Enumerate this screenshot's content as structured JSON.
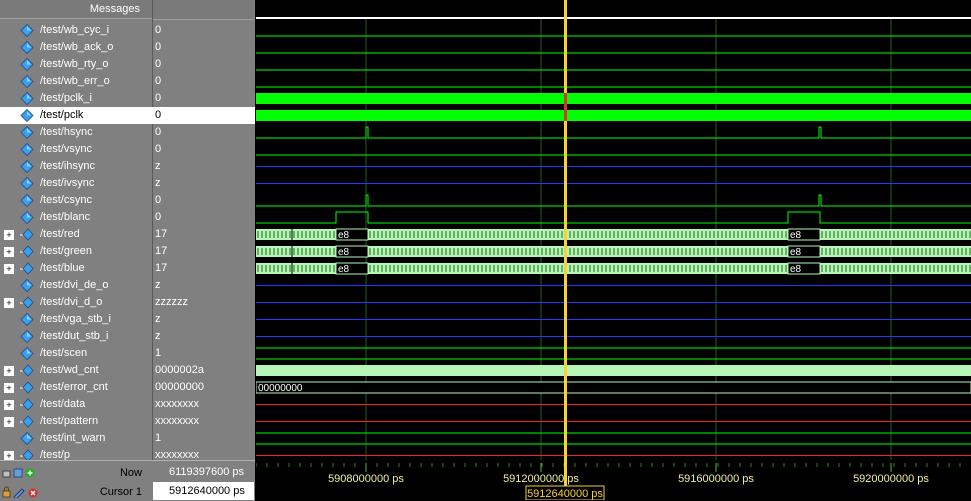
{
  "header": {
    "messages_label": "Messages"
  },
  "signals": [
    {
      "name": "/test/wb_cyc_i",
      "value": "0",
      "expandable": false,
      "selected": false
    },
    {
      "name": "/test/wb_ack_o",
      "value": "0",
      "expandable": false,
      "selected": false
    },
    {
      "name": "/test/wb_rty_o",
      "value": "0",
      "expandable": false,
      "selected": false
    },
    {
      "name": "/test/wb_err_o",
      "value": "0",
      "expandable": false,
      "selected": false
    },
    {
      "name": "/test/pclk_i",
      "value": "0",
      "expandable": false,
      "selected": false
    },
    {
      "name": "/test/pclk",
      "value": "0",
      "expandable": false,
      "selected": true
    },
    {
      "name": "/test/hsync",
      "value": "0",
      "expandable": false,
      "selected": false
    },
    {
      "name": "/test/vsync",
      "value": "0",
      "expandable": false,
      "selected": false
    },
    {
      "name": "/test/ihsync",
      "value": "z",
      "expandable": false,
      "selected": false
    },
    {
      "name": "/test/ivsync",
      "value": "z",
      "expandable": false,
      "selected": false
    },
    {
      "name": "/test/csync",
      "value": "0",
      "expandable": false,
      "selected": false
    },
    {
      "name": "/test/blanc",
      "value": "0",
      "expandable": false,
      "selected": false
    },
    {
      "name": "/test/red",
      "value": "17",
      "expandable": true,
      "selected": false
    },
    {
      "name": "/test/green",
      "value": "17",
      "expandable": true,
      "selected": false
    },
    {
      "name": "/test/blue",
      "value": "17",
      "expandable": true,
      "selected": false
    },
    {
      "name": "/test/dvi_de_o",
      "value": "z",
      "expandable": false,
      "selected": false
    },
    {
      "name": "/test/dvi_d_o",
      "value": "zzzzzz",
      "expandable": true,
      "selected": false
    },
    {
      "name": "/test/vga_stb_i",
      "value": "z",
      "expandable": false,
      "selected": false
    },
    {
      "name": "/test/dut_stb_i",
      "value": "z",
      "expandable": false,
      "selected": false
    },
    {
      "name": "/test/scen",
      "value": "1",
      "expandable": false,
      "selected": false
    },
    {
      "name": "/test/wd_cnt",
      "value": "0000002a",
      "expandable": true,
      "selected": false
    },
    {
      "name": "/test/error_cnt",
      "value": "00000000",
      "expandable": true,
      "selected": false
    },
    {
      "name": "/test/data",
      "value": "xxxxxxxx",
      "expandable": true,
      "selected": false
    },
    {
      "name": "/test/pattern",
      "value": "xxxxxxxx",
      "expandable": true,
      "selected": false
    },
    {
      "name": "/test/int_warn",
      "value": "1",
      "expandable": false,
      "selected": false
    },
    {
      "name": "/test/p",
      "value": "xxxxxxxx",
      "expandable": true,
      "selected": false
    }
  ],
  "wave_labels": {
    "rgb_value": "e8",
    "error_cnt_value": "00000000"
  },
  "footer": {
    "now_label": "Now",
    "now_value": "6119397600 ps",
    "cursor_label": "Cursor 1",
    "cursor_value": "5912640000 ps"
  },
  "timeline": {
    "ticks": [
      "5908000000 ps",
      "5912000000 ps",
      "5916000000 ps",
      "5920000000 ps"
    ],
    "cursor_readout": "5912640000 ps"
  },
  "colors": {
    "wave_green": "#00ff00",
    "bus_fill": "#b6f5b6",
    "cursor": "#f6d13a",
    "zline": "#1e3cff",
    "xline": "#ff2020"
  },
  "icons": {
    "signal": "diamond-signal-icon",
    "bus": "bus-signal-icon",
    "lock": "lock-icon",
    "edit": "pencil-icon",
    "zoom": "magnifier-icon",
    "add": "add-icon"
  }
}
